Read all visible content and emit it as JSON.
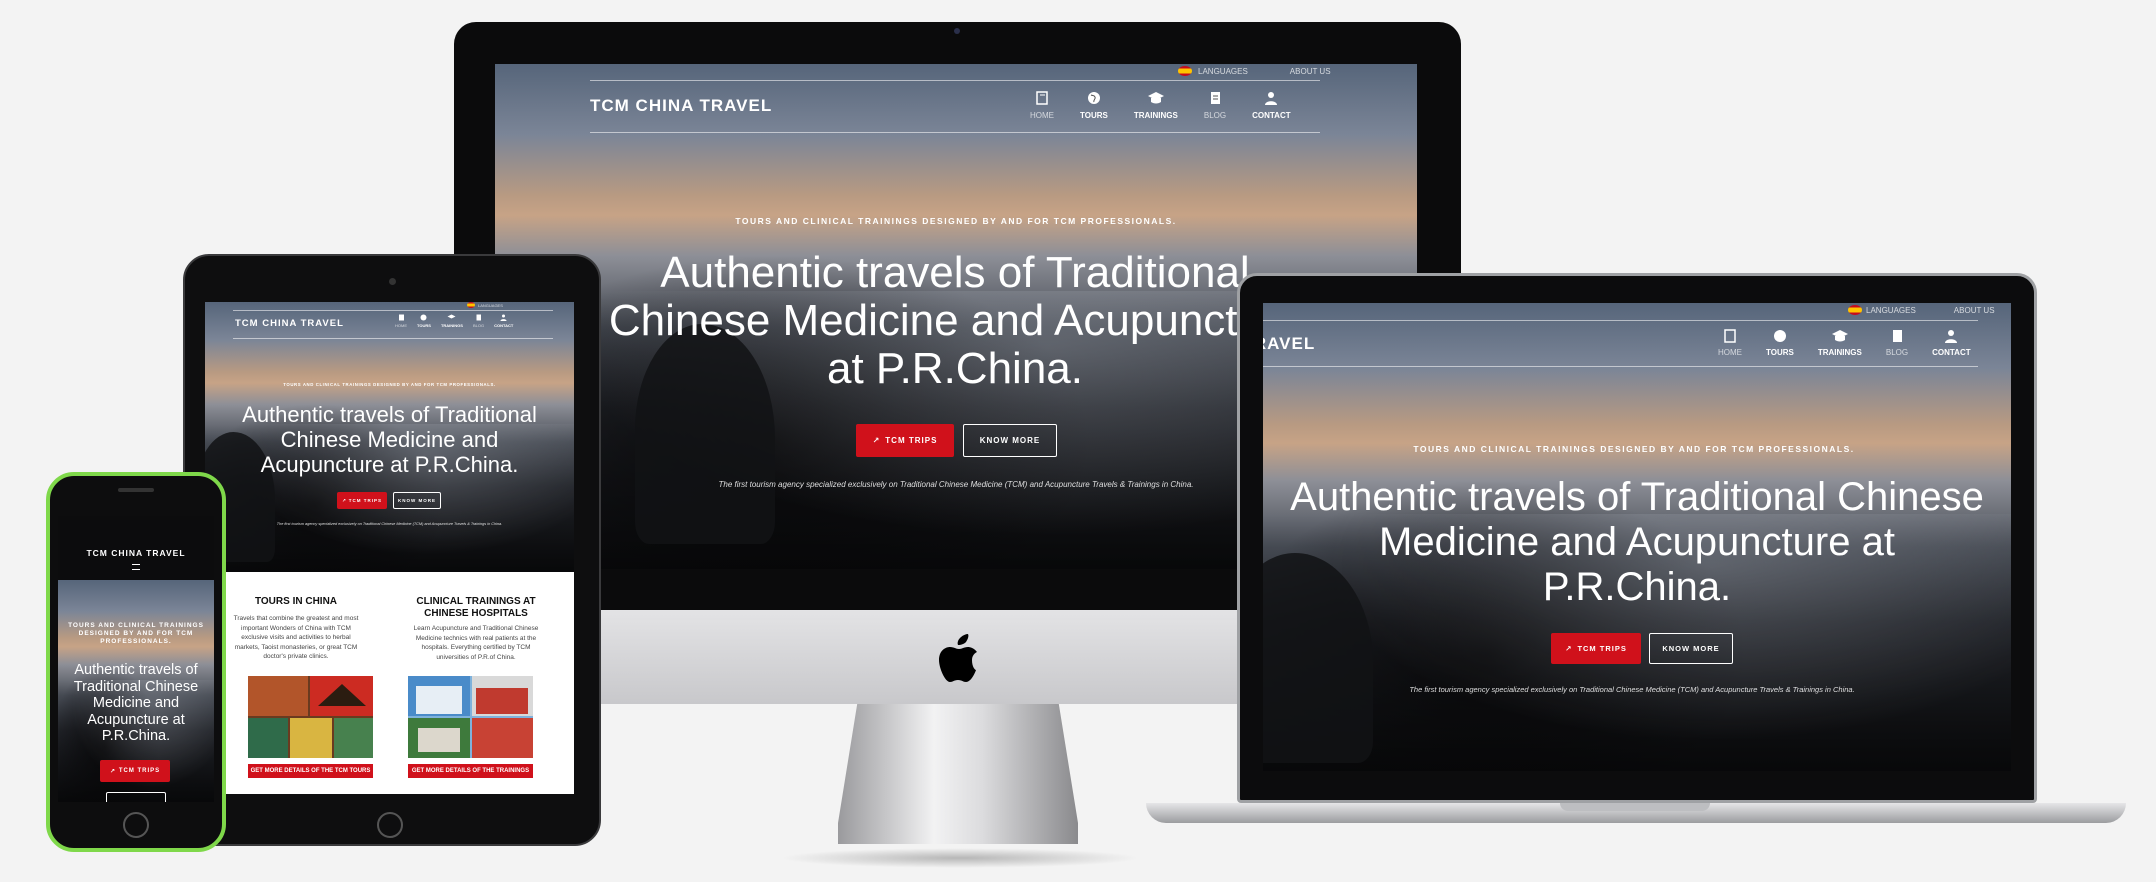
{
  "site": {
    "brand": "TCM CHINA TRAVEL",
    "top_links": {
      "languages": "LANGUAGES",
      "about": "ABOUT US"
    },
    "menu": [
      {
        "label": "HOME",
        "icon": "book-icon"
      },
      {
        "label": "TOURS",
        "icon": "globe-icon"
      },
      {
        "label": "TRAININGS",
        "icon": "graduation-cap-icon"
      },
      {
        "label": "BLOG",
        "icon": "document-icon"
      },
      {
        "label": "CONTACT",
        "icon": "user-icon"
      }
    ],
    "tagline": "TOURS AND CLINICAL TRAININGS DESIGNED BY AND FOR TCM PROFESSIONALS.",
    "headline": "Authentic travels of Traditional Chinese Medicine and Acupuncture at P.R.China.",
    "buttons": {
      "trips": "TCM TRIPS",
      "know_more": "KNOW MORE"
    },
    "subline": "The first tourism agency specialized exclusively on Traditional Chinese Medicine (TCM) and Acupuncture Travels & Trainings in China.",
    "colors": {
      "accent_red": "#d0111b",
      "phone_frame": "#7fd84a"
    }
  },
  "tablet": {
    "cards": [
      {
        "title": "TOURS IN CHINA",
        "text": "Travels that combine the greatest and most important Wonders of China with TCM exclusive visits and activities to herbal markets, Taoist monasteries, or great TCM doctor's private clinics.",
        "button": "GET MORE DETAILS OF THE TCM TOURS"
      },
      {
        "title": "CLINICAL TRAININGS AT CHINESE HOSPITALS",
        "text": "Learn Acupuncture and Traditional Chinese Medicine technics with real patients at the hospitals. Everything certified by TCM universities of P.R.of China.",
        "button": "GET MORE DETAILS OF THE TRAININGS"
      }
    ]
  }
}
